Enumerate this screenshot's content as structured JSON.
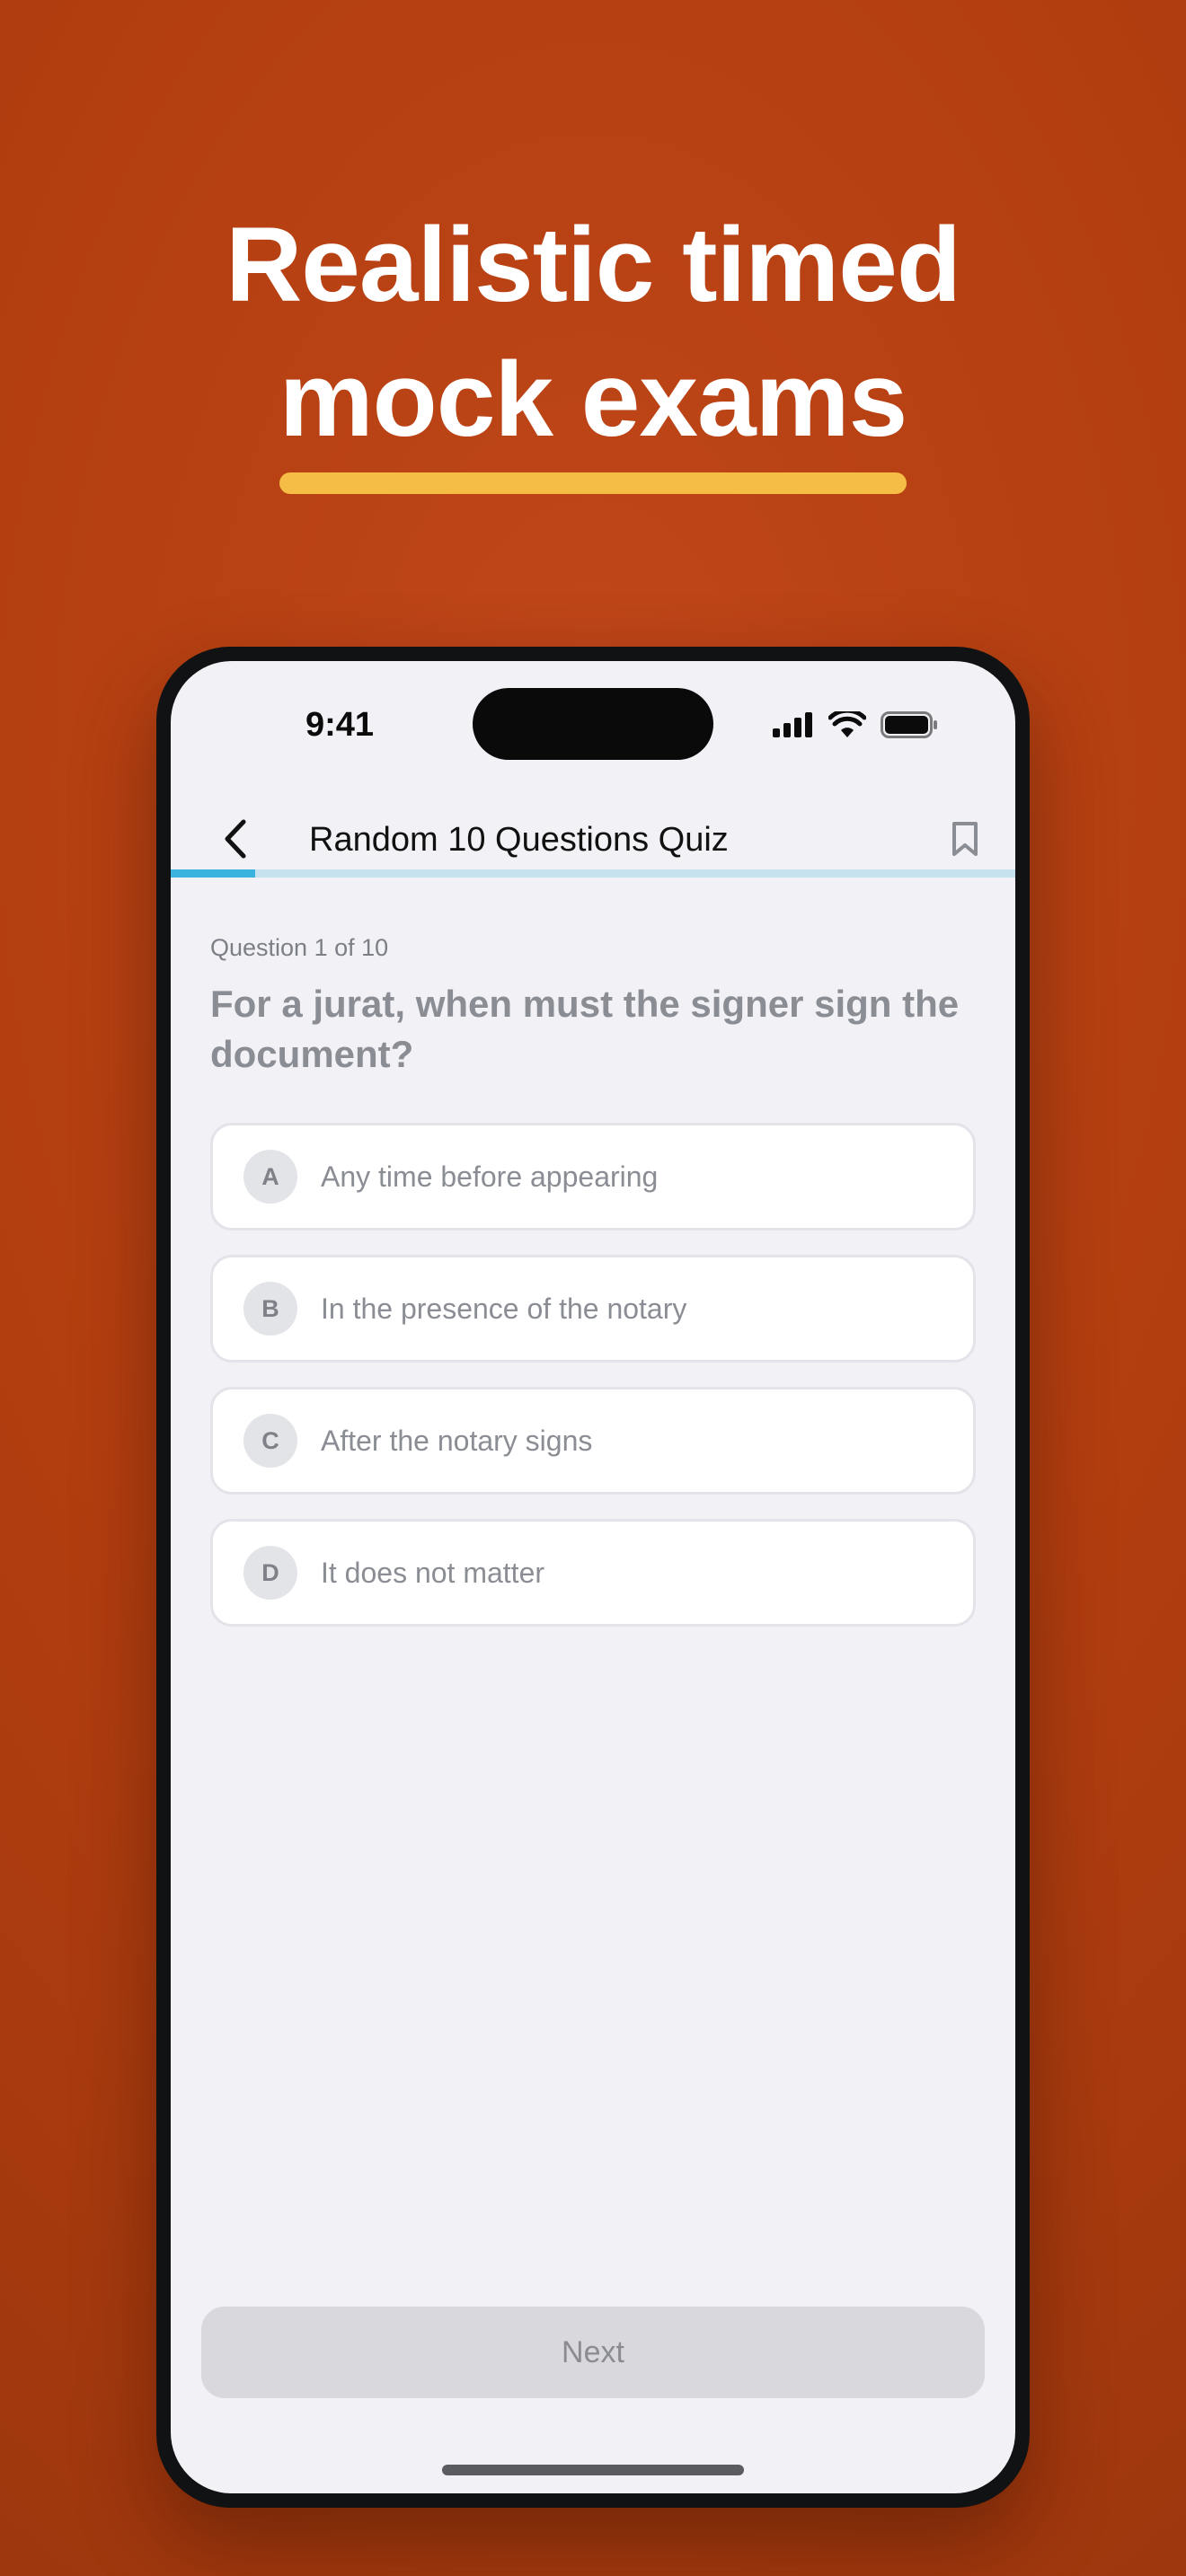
{
  "headline": {
    "line1": "Realistic timed",
    "line2": "mock exams",
    "underline_color": "#f5bd45"
  },
  "status_bar": {
    "time": "9:41",
    "icons": [
      "cellular-signal-icon",
      "wifi-icon",
      "battery-icon"
    ]
  },
  "nav": {
    "back_icon": "chevron-left-icon",
    "title": "Random 10 Questions Quiz",
    "bookmark_icon": "bookmark-icon"
  },
  "progress": {
    "current": 1,
    "total": 10,
    "fraction": 0.1,
    "fill_color": "#3ab3de",
    "track_color": "#c5e2ee"
  },
  "question": {
    "counter": "Question 1 of 10",
    "text": "For a jurat, when must the signer sign the document?"
  },
  "options": [
    {
      "letter": "A",
      "text": "Any time before appearing"
    },
    {
      "letter": "B",
      "text": "In the presence of the notary"
    },
    {
      "letter": "C",
      "text": "After the notary signs"
    },
    {
      "letter": "D",
      "text": "It does not matter"
    }
  ],
  "footer": {
    "next_label": "Next"
  },
  "colors": {
    "background": "#b33e0f",
    "screen_background": "#f1f1f6"
  }
}
